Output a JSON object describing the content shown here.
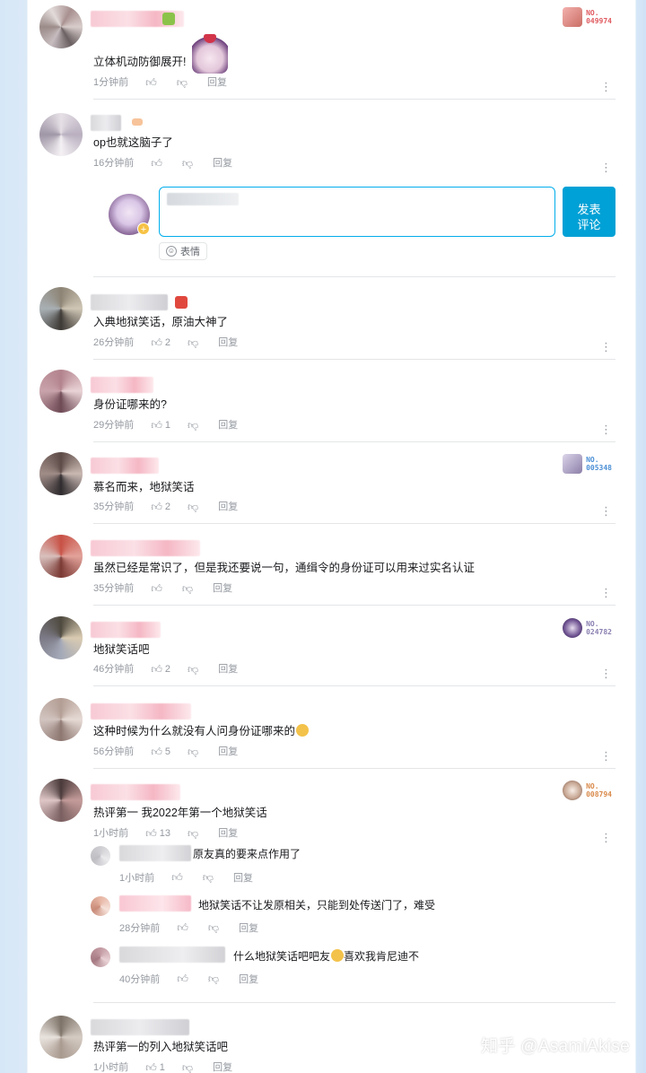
{
  "comments": [
    {
      "text": "立体机动防御展开!",
      "time": "1分钟前",
      "likes": "",
      "reply": "回复",
      "no_label": "NO.",
      "no_value": "049974"
    },
    {
      "text": "op也就这脑子了",
      "time": "16分钟前",
      "likes": "",
      "reply": "回复"
    },
    {
      "text": "入典地狱笑话，原油大神了",
      "time": "26分钟前",
      "likes": "2",
      "reply": "回复"
    },
    {
      "text": "身份证哪来的?",
      "time": "29分钟前",
      "likes": "1",
      "reply": "回复"
    },
    {
      "text": "慕名而来，地狱笑话",
      "time": "35分钟前",
      "likes": "2",
      "reply": "回复",
      "no_label": "NO.",
      "no_value": "005348"
    },
    {
      "text": "虽然已经是常识了，但是我还要说一句，通缉令的身份证可以用来过实名认证",
      "time": "35分钟前",
      "likes": "",
      "reply": "回复"
    },
    {
      "text": "地狱笑话吧",
      "time": "46分钟前",
      "likes": "2",
      "reply": "回复",
      "no_label": "NO.",
      "no_value": "024782"
    },
    {
      "text": "这种时候为什么就没有人问身份证哪来的",
      "time": "56分钟前",
      "likes": "5",
      "reply": "回复"
    },
    {
      "text": "热评第一 我2022年第一个地狱笑话",
      "time": "1小时前",
      "likes": "13",
      "reply": "回复",
      "no_label": "NO.",
      "no_value": "008794"
    },
    {
      "text": "热评第一的列入地狱笑话吧",
      "time": "1小时前",
      "likes": "1",
      "reply": "回复"
    }
  ],
  "sub_replies": [
    {
      "text": "原友真的要来点作用了",
      "time": "1小时前",
      "reply": "回复"
    },
    {
      "text": "地狱笑话不让发原相关，只能到处传送门了，难受",
      "time": "28分钟前",
      "reply": "回复"
    },
    {
      "text_before": "什么地狱笑话吧吧友",
      "text_after": "喜欢我肯尼迪不",
      "time": "40分钟前",
      "reply": "回复"
    }
  ],
  "editor": {
    "send_label_line1": "发表",
    "send_label_line2": "评论",
    "emoji_label": "表情"
  },
  "watermark": "知乎 @AsamiAkise",
  "icons": {
    "like": "thumb-up-icon",
    "dislike": "thumb-down-icon",
    "more": "more-vertical-icon"
  },
  "colors": {
    "accent": "#00a1d6",
    "meta": "#9499a0"
  }
}
